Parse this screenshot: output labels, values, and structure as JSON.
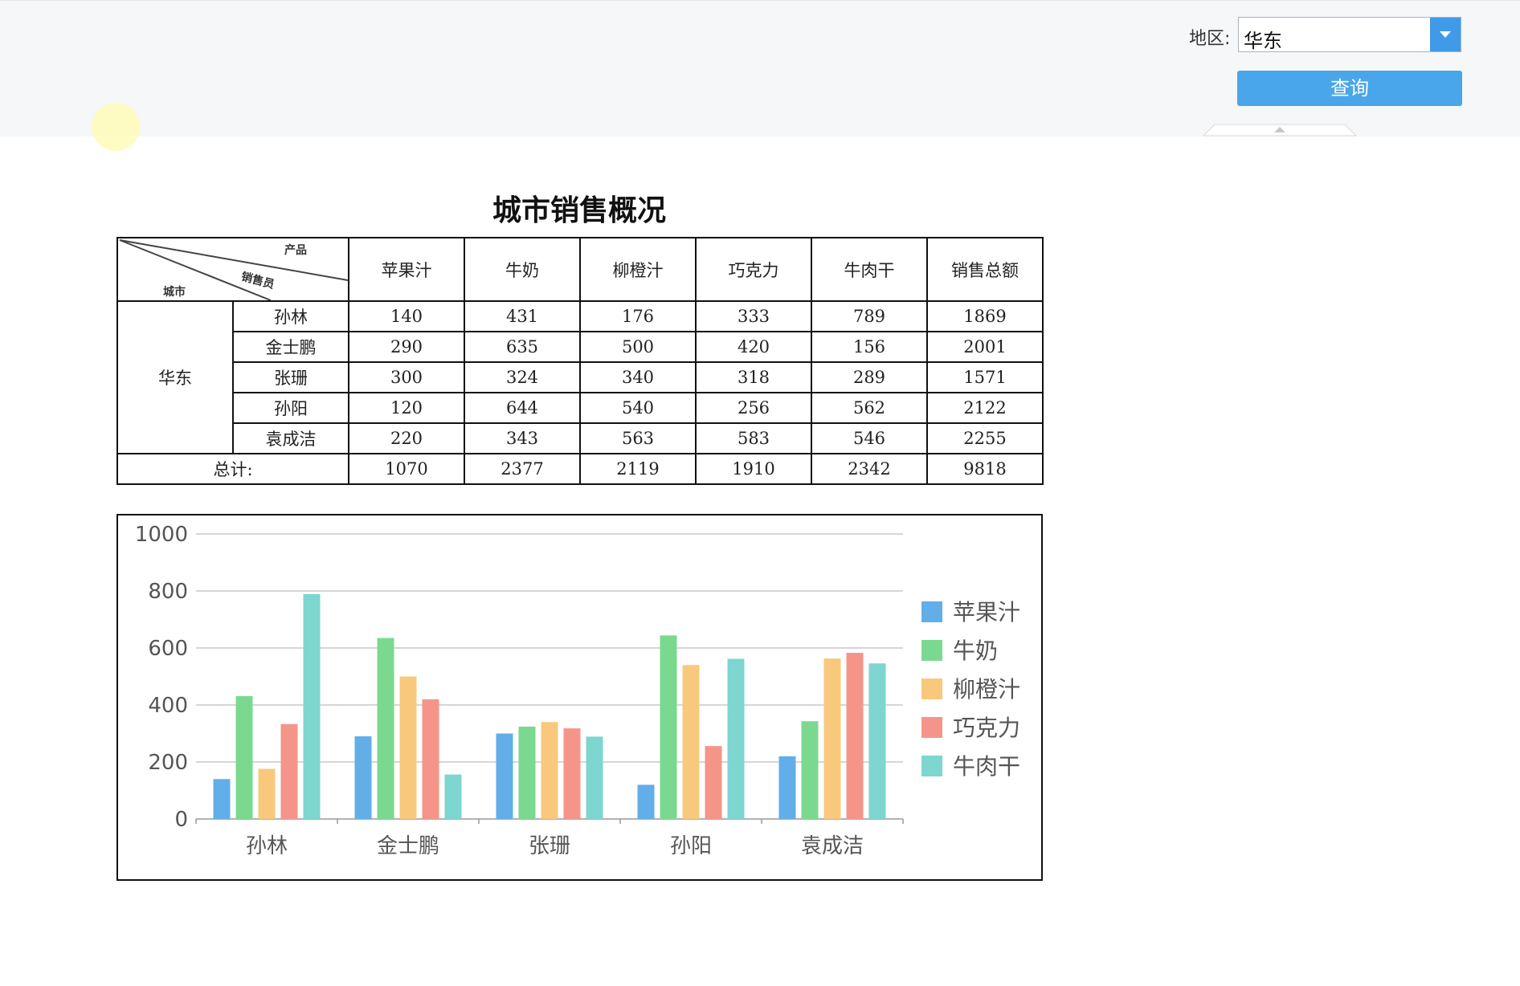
{
  "filter": {
    "region_label": "地区:",
    "region_value": "华东",
    "query_button": "查询"
  },
  "report": {
    "title": "城市销售概况",
    "corner": {
      "product": "产品",
      "salesperson": "销售员",
      "city": "城市"
    },
    "columns": [
      "苹果汁",
      "牛奶",
      "柳橙汁",
      "巧克力",
      "牛肉干",
      "销售总额"
    ],
    "city": "华东",
    "rows": [
      {
        "name": "孙林",
        "values": [
          140,
          431,
          176,
          333,
          789,
          1869
        ]
      },
      {
        "name": "金士鹏",
        "values": [
          290,
          635,
          500,
          420,
          156,
          2001
        ]
      },
      {
        "name": "张珊",
        "values": [
          300,
          324,
          340,
          318,
          289,
          1571
        ]
      },
      {
        "name": "孙阳",
        "values": [
          120,
          644,
          540,
          256,
          562,
          2122
        ]
      },
      {
        "name": "袁成洁",
        "values": [
          220,
          343,
          563,
          583,
          546,
          2255
        ]
      }
    ],
    "total_label": "总计:",
    "totals": [
      1070,
      2377,
      2119,
      1910,
      2342,
      9818
    ]
  },
  "chart_data": {
    "type": "bar",
    "categories": [
      "孙林",
      "金士鹏",
      "张珊",
      "孙阳",
      "袁成洁"
    ],
    "series": [
      {
        "name": "苹果汁",
        "color": "#62aee8",
        "values": [
          140,
          290,
          300,
          120,
          220
        ]
      },
      {
        "name": "牛奶",
        "color": "#7bd98f",
        "values": [
          431,
          635,
          324,
          644,
          343
        ]
      },
      {
        "name": "柳橙汁",
        "color": "#f8c97d",
        "values": [
          176,
          500,
          340,
          540,
          563
        ]
      },
      {
        "name": "巧克力",
        "color": "#f5958a",
        "values": [
          333,
          420,
          318,
          256,
          583
        ]
      },
      {
        "name": "牛肉干",
        "color": "#7dd6cf",
        "values": [
          789,
          156,
          289,
          562,
          546
        ]
      }
    ],
    "yticks": [
      0,
      200,
      400,
      600,
      800,
      1000
    ],
    "ylim": [
      0,
      1000
    ],
    "grid": true,
    "legend": "right"
  }
}
